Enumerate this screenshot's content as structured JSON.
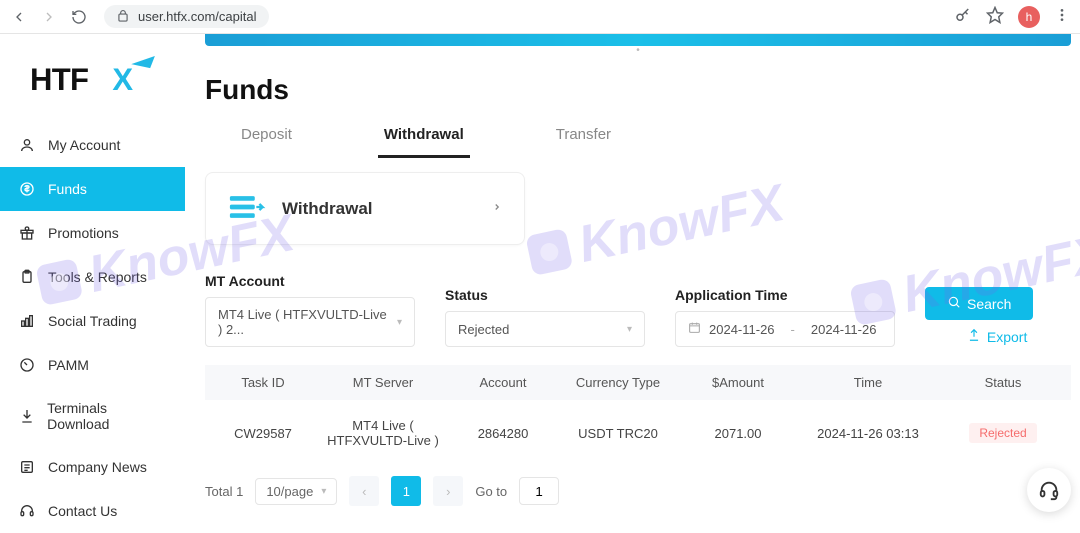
{
  "browser": {
    "url": "user.htfx.com/capital",
    "profile_initial": "h"
  },
  "brand": {
    "name": "HTFX"
  },
  "sidebar": {
    "items": [
      {
        "label": "My Account"
      },
      {
        "label": "Funds"
      },
      {
        "label": "Promotions"
      },
      {
        "label": "Tools & Reports"
      },
      {
        "label": "Social Trading"
      },
      {
        "label": "PAMM"
      },
      {
        "label": "Terminals Download"
      },
      {
        "label": "Company News"
      },
      {
        "label": "Contact Us"
      }
    ],
    "active_index": 1
  },
  "page": {
    "title": "Funds",
    "tabs": [
      {
        "label": "Deposit"
      },
      {
        "label": "Withdrawal"
      },
      {
        "label": "Transfer"
      }
    ],
    "active_tab": 1,
    "card_title": "Withdrawal"
  },
  "filters": {
    "mt_account": {
      "label": "MT Account",
      "value": "MT4 Live ( HTFXVULTD-Live ) 2..."
    },
    "status": {
      "label": "Status",
      "value": "Rejected"
    },
    "app_time": {
      "label": "Application Time",
      "from": "2024-11-26",
      "separator": "-",
      "to": "2024-11-26"
    },
    "search_label": "Search",
    "export_label": "Export"
  },
  "table": {
    "headers": [
      "Task ID",
      "MT Server",
      "Account",
      "Currency Type",
      "$Amount",
      "Time",
      "Status"
    ],
    "rows": [
      {
        "task_id": "CW29587",
        "mt_server": "MT4 Live ( HTFXVULTD-Live )",
        "account": "2864280",
        "currency_type": "USDT TRC20",
        "amount": "2071.00",
        "time": "2024-11-26 03:13",
        "status": "Rejected"
      }
    ]
  },
  "pagination": {
    "total_label": "Total 1",
    "per_page": "10/page",
    "current": "1",
    "goto_label": "Go to",
    "goto_value": "1"
  },
  "watermark": "KnowFX"
}
